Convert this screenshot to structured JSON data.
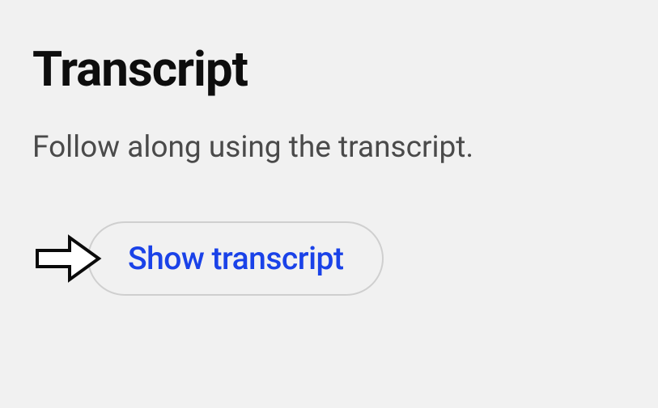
{
  "section": {
    "heading": "Transcript",
    "description": "Follow along using the transcript.",
    "button_label": "Show transcript"
  }
}
